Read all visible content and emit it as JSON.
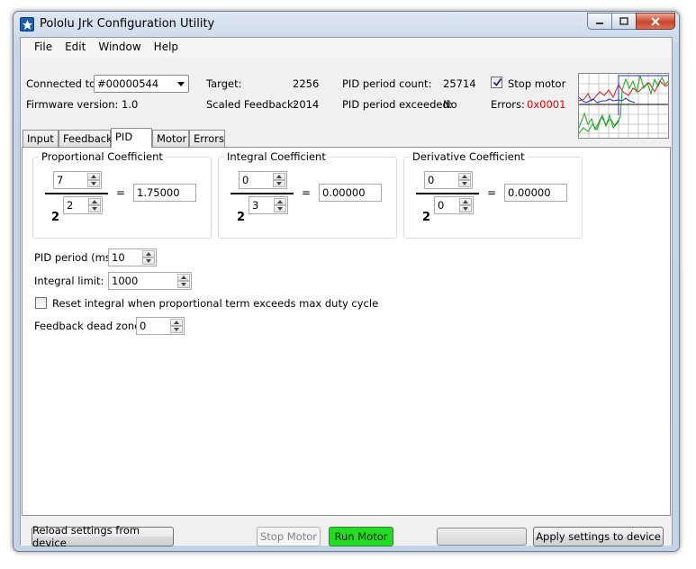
{
  "window": {
    "title": "Pololu Jrk Configuration Utility"
  },
  "menu": [
    "File",
    "Edit",
    "Window",
    "Help"
  ],
  "status": {
    "connected_label": "Connected to:",
    "connected_value": "#00000544",
    "firmware_label": "Firmware version: 1.0",
    "target_label": "Target:",
    "target_value": "2256",
    "scaled_label": "Scaled Feedback:",
    "scaled_value": "2014",
    "pid_count_label": "PID period count:",
    "pid_count_value": "25714",
    "pid_exceeded_label": "PID period exceeded:",
    "pid_exceeded_value": "No",
    "stop_motor_label": "Stop motor",
    "stop_motor_checked": true,
    "errors_label": "Errors:",
    "errors_value": "0x0001"
  },
  "tabs": [
    "Input",
    "Feedback",
    "PID",
    "Motor",
    "Errors"
  ],
  "active_tab": "PID",
  "pid": {
    "proportional": {
      "title": "Proportional Coefficient",
      "numerator": "7",
      "exponent": "2",
      "base": "2",
      "result": "1.75000"
    },
    "integral": {
      "title": "Integral Coefficient",
      "numerator": "0",
      "exponent": "3",
      "base": "2",
      "result": "0.00000"
    },
    "derivative": {
      "title": "Derivative Coefficient",
      "numerator": "0",
      "exponent": "0",
      "base": "2",
      "result": "0.00000"
    },
    "equals": "=",
    "period_label": "PID period (ms):",
    "period_value": "10",
    "integral_limit_label": "Integral limit:",
    "integral_limit_value": "1000",
    "reset_integral_label": "Reset integral when proportional term exceeds max duty cycle",
    "reset_integral_checked": false,
    "dead_zone_label": "Feedback dead zone:",
    "dead_zone_value": "0"
  },
  "buttons": {
    "reload": "Reload settings from device",
    "stop": "Stop Motor",
    "run": "Run Motor",
    "apply": "Apply settings to device"
  },
  "colors": {
    "run_motor": "#22dd22",
    "error_text": "#e00000"
  }
}
